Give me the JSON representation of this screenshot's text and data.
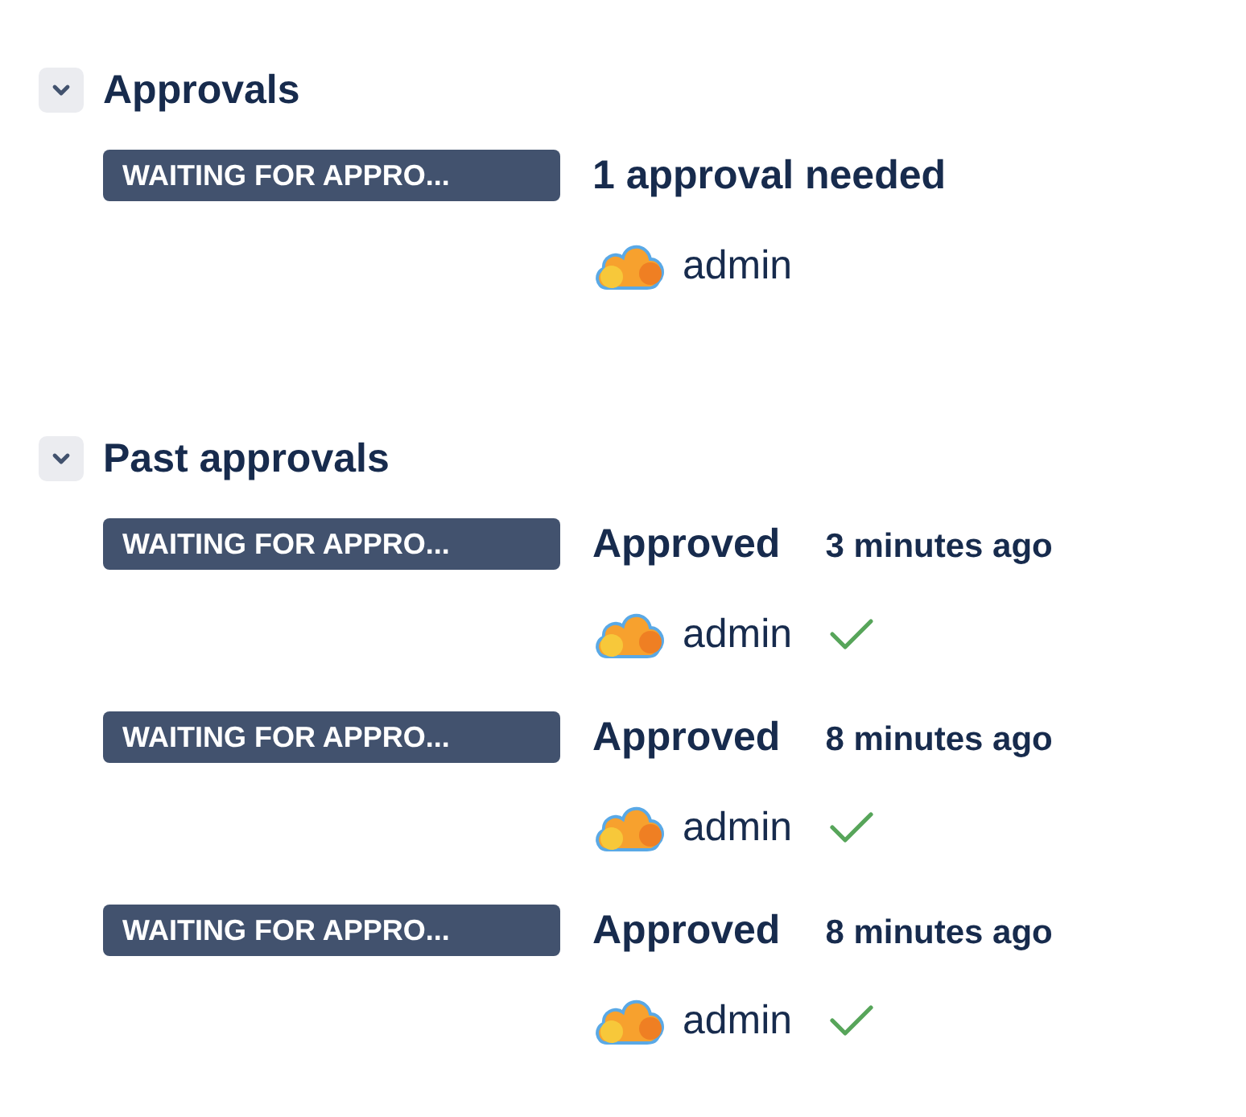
{
  "sections": [
    {
      "title": "Approvals",
      "expanded": true,
      "items": [
        {
          "status": "WAITING FOR APPRO...",
          "title": "1 approval needed",
          "approver": {
            "name": "admin",
            "approved": false
          }
        }
      ]
    },
    {
      "title": "Past approvals",
      "expanded": true,
      "items": [
        {
          "status": "WAITING FOR APPRO...",
          "title": "Approved",
          "time": "3 minutes ago",
          "approver": {
            "name": "admin",
            "approved": true
          }
        },
        {
          "status": "WAITING FOR APPRO...",
          "title": "Approved",
          "time": "8 minutes ago",
          "approver": {
            "name": "admin",
            "approved": true
          }
        },
        {
          "status": "WAITING FOR APPRO...",
          "title": "Approved",
          "time": "8 minutes ago",
          "approver": {
            "name": "admin",
            "approved": true
          }
        }
      ]
    }
  ]
}
